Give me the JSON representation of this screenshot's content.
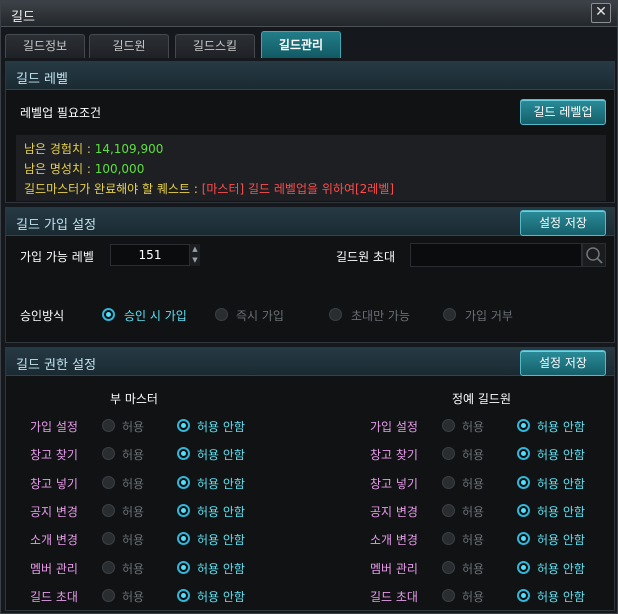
{
  "window": {
    "title": "길드"
  },
  "tabs": [
    {
      "label": "길드정보",
      "active": false
    },
    {
      "label": "길드원",
      "active": false
    },
    {
      "label": "길드스킬",
      "active": false
    },
    {
      "label": "길드관리",
      "active": true
    }
  ],
  "level_section": {
    "title": "길드 레벨",
    "requirement_label": "레벨업 필요조건",
    "levelup_button": "길드 레벨업",
    "exp_label": "남은 경험치 :",
    "exp_value": "14,109,900",
    "fame_label": "남은 명성치 :",
    "fame_value": "100,000",
    "quest_label": "길드마스터가 완료해야 할 퀘스트 :",
    "quest_value": "[마스터] 길드 레벨업을 위하여[2레벨]"
  },
  "join_section": {
    "title": "길드 가입 설정",
    "save_button": "설정 저장",
    "level_label": "가입 가능 레벨",
    "level_value": "151",
    "invite_label": "길드원 초대",
    "invite_value": "",
    "approval_label": "승인방식",
    "approval_options": [
      {
        "label": "승인 시 가입",
        "selected": true
      },
      {
        "label": "즉시 가입",
        "selected": false
      },
      {
        "label": "초대만 가능",
        "selected": false
      },
      {
        "label": "가입 거부",
        "selected": false
      }
    ]
  },
  "perm_section": {
    "title": "길드 권한 설정",
    "save_button": "설정 저장",
    "allow_label": "허용",
    "deny_label": "허용 안함",
    "columns": [
      {
        "title": "부 마스터"
      },
      {
        "title": "정예 길드원"
      }
    ],
    "rows": [
      {
        "label": "가입 설정",
        "vice_allow": false,
        "elite_allow": false
      },
      {
        "label": "창고 찾기",
        "vice_allow": false,
        "elite_allow": false
      },
      {
        "label": "창고 넣기",
        "vice_allow": false,
        "elite_allow": false
      },
      {
        "label": "공지 변경",
        "vice_allow": false,
        "elite_allow": false
      },
      {
        "label": "소개 변경",
        "vice_allow": false,
        "elite_allow": false
      },
      {
        "label": "멤버 관리",
        "vice_allow": false,
        "elite_allow": false
      },
      {
        "label": "길드 초대",
        "vice_allow": false,
        "elite_allow": false
      }
    ]
  },
  "icons": {
    "close": "close-icon",
    "search": "search-icon",
    "stepper_up": "triangle-up-icon",
    "stepper_down": "triangle-down-icon"
  },
  "colors": {
    "accent": "#2fb6d8",
    "label_yellow": "#e8d24a",
    "value_green": "#5de03c",
    "quest_red": "#ff4d4d",
    "perm_label": "#e79bea"
  }
}
